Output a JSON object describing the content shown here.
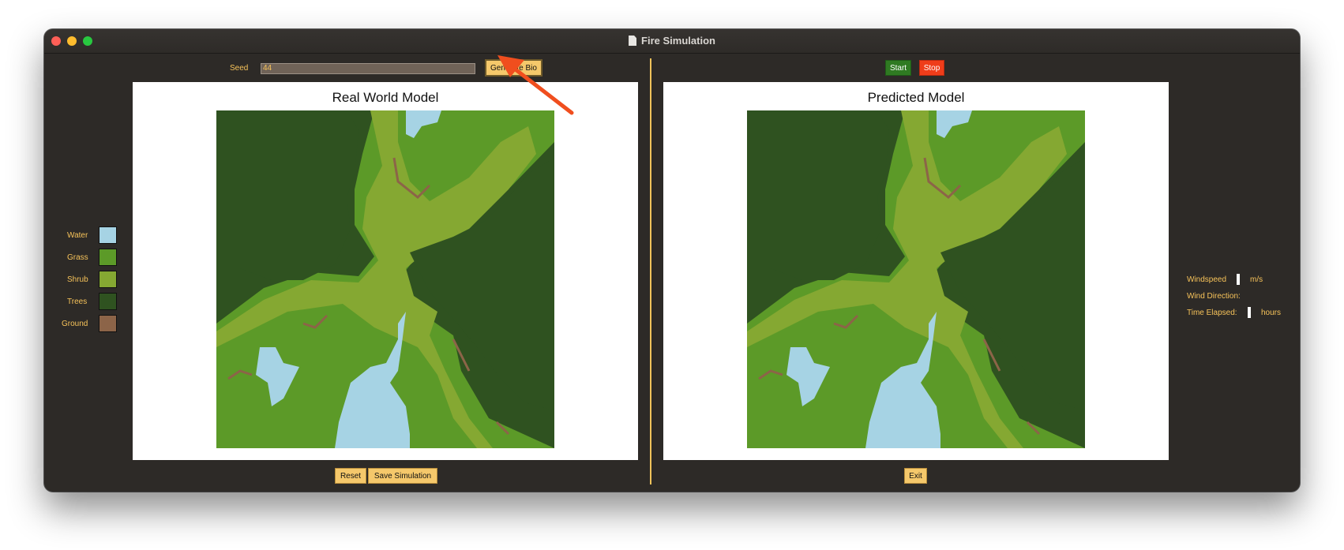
{
  "window": {
    "title": "Fire Simulation"
  },
  "controls": {
    "seed_label": "Seed",
    "seed_value": "44",
    "generate_label": "Generate Bio",
    "start_label": "Start",
    "stop_label": "Stop",
    "reset_label": "Reset",
    "save_label": "Save Simulation",
    "exit_label": "Exit"
  },
  "legend": {
    "items": [
      {
        "label": "Water",
        "color": "#a6d3e4"
      },
      {
        "label": "Grass",
        "color": "#5c9a28"
      },
      {
        "label": "Shrub",
        "color": "#85a832"
      },
      {
        "label": "Trees",
        "color": "#2f5220"
      },
      {
        "label": "Ground",
        "color": "#8c6448"
      }
    ]
  },
  "panels": {
    "real": {
      "title": "Real World Model"
    },
    "predicted": {
      "title": "Predicted Model"
    }
  },
  "stats": {
    "windspeed_label": "Windspeed",
    "windspeed_unit": "m/s",
    "wind_direction_label": "Wind Direction:",
    "time_elapsed_label": "Time Elapsed:",
    "time_unit": "hours"
  },
  "colors": {
    "accent": "#f7c35a",
    "window_bg": "#2d2a27",
    "start": "#2f7a22",
    "stop": "#ef3d1a",
    "annotation_arrow": "#f04e1e"
  }
}
